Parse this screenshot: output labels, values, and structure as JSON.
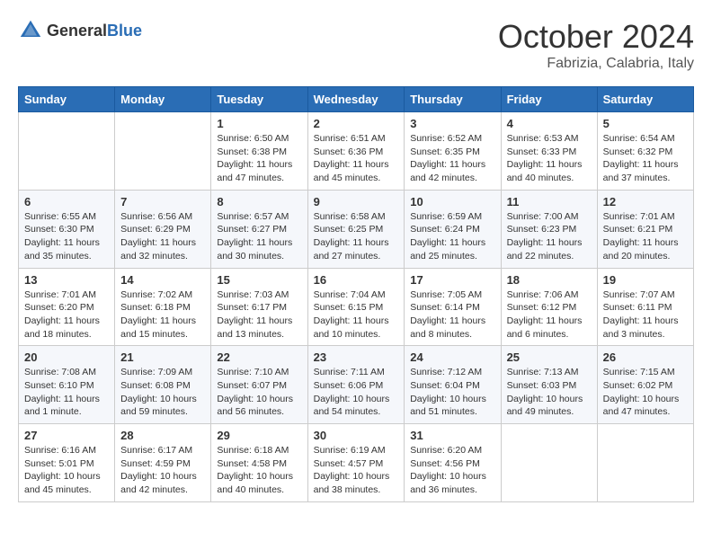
{
  "header": {
    "logo_general": "General",
    "logo_blue": "Blue",
    "month_title": "October 2024",
    "subtitle": "Fabrizia, Calabria, Italy"
  },
  "days_of_week": [
    "Sunday",
    "Monday",
    "Tuesday",
    "Wednesday",
    "Thursday",
    "Friday",
    "Saturday"
  ],
  "weeks": [
    [
      {
        "day": "",
        "content": ""
      },
      {
        "day": "",
        "content": ""
      },
      {
        "day": "1",
        "content": "Sunrise: 6:50 AM\nSunset: 6:38 PM\nDaylight: 11 hours and 47 minutes."
      },
      {
        "day": "2",
        "content": "Sunrise: 6:51 AM\nSunset: 6:36 PM\nDaylight: 11 hours and 45 minutes."
      },
      {
        "day": "3",
        "content": "Sunrise: 6:52 AM\nSunset: 6:35 PM\nDaylight: 11 hours and 42 minutes."
      },
      {
        "day": "4",
        "content": "Sunrise: 6:53 AM\nSunset: 6:33 PM\nDaylight: 11 hours and 40 minutes."
      },
      {
        "day": "5",
        "content": "Sunrise: 6:54 AM\nSunset: 6:32 PM\nDaylight: 11 hours and 37 minutes."
      }
    ],
    [
      {
        "day": "6",
        "content": "Sunrise: 6:55 AM\nSunset: 6:30 PM\nDaylight: 11 hours and 35 minutes."
      },
      {
        "day": "7",
        "content": "Sunrise: 6:56 AM\nSunset: 6:29 PM\nDaylight: 11 hours and 32 minutes."
      },
      {
        "day": "8",
        "content": "Sunrise: 6:57 AM\nSunset: 6:27 PM\nDaylight: 11 hours and 30 minutes."
      },
      {
        "day": "9",
        "content": "Sunrise: 6:58 AM\nSunset: 6:25 PM\nDaylight: 11 hours and 27 minutes."
      },
      {
        "day": "10",
        "content": "Sunrise: 6:59 AM\nSunset: 6:24 PM\nDaylight: 11 hours and 25 minutes."
      },
      {
        "day": "11",
        "content": "Sunrise: 7:00 AM\nSunset: 6:23 PM\nDaylight: 11 hours and 22 minutes."
      },
      {
        "day": "12",
        "content": "Sunrise: 7:01 AM\nSunset: 6:21 PM\nDaylight: 11 hours and 20 minutes."
      }
    ],
    [
      {
        "day": "13",
        "content": "Sunrise: 7:01 AM\nSunset: 6:20 PM\nDaylight: 11 hours and 18 minutes."
      },
      {
        "day": "14",
        "content": "Sunrise: 7:02 AM\nSunset: 6:18 PM\nDaylight: 11 hours and 15 minutes."
      },
      {
        "day": "15",
        "content": "Sunrise: 7:03 AM\nSunset: 6:17 PM\nDaylight: 11 hours and 13 minutes."
      },
      {
        "day": "16",
        "content": "Sunrise: 7:04 AM\nSunset: 6:15 PM\nDaylight: 11 hours and 10 minutes."
      },
      {
        "day": "17",
        "content": "Sunrise: 7:05 AM\nSunset: 6:14 PM\nDaylight: 11 hours and 8 minutes."
      },
      {
        "day": "18",
        "content": "Sunrise: 7:06 AM\nSunset: 6:12 PM\nDaylight: 11 hours and 6 minutes."
      },
      {
        "day": "19",
        "content": "Sunrise: 7:07 AM\nSunset: 6:11 PM\nDaylight: 11 hours and 3 minutes."
      }
    ],
    [
      {
        "day": "20",
        "content": "Sunrise: 7:08 AM\nSunset: 6:10 PM\nDaylight: 11 hours and 1 minute."
      },
      {
        "day": "21",
        "content": "Sunrise: 7:09 AM\nSunset: 6:08 PM\nDaylight: 10 hours and 59 minutes."
      },
      {
        "day": "22",
        "content": "Sunrise: 7:10 AM\nSunset: 6:07 PM\nDaylight: 10 hours and 56 minutes."
      },
      {
        "day": "23",
        "content": "Sunrise: 7:11 AM\nSunset: 6:06 PM\nDaylight: 10 hours and 54 minutes."
      },
      {
        "day": "24",
        "content": "Sunrise: 7:12 AM\nSunset: 6:04 PM\nDaylight: 10 hours and 51 minutes."
      },
      {
        "day": "25",
        "content": "Sunrise: 7:13 AM\nSunset: 6:03 PM\nDaylight: 10 hours and 49 minutes."
      },
      {
        "day": "26",
        "content": "Sunrise: 7:15 AM\nSunset: 6:02 PM\nDaylight: 10 hours and 47 minutes."
      }
    ],
    [
      {
        "day": "27",
        "content": "Sunrise: 6:16 AM\nSunset: 5:01 PM\nDaylight: 10 hours and 45 minutes."
      },
      {
        "day": "28",
        "content": "Sunrise: 6:17 AM\nSunset: 4:59 PM\nDaylight: 10 hours and 42 minutes."
      },
      {
        "day": "29",
        "content": "Sunrise: 6:18 AM\nSunset: 4:58 PM\nDaylight: 10 hours and 40 minutes."
      },
      {
        "day": "30",
        "content": "Sunrise: 6:19 AM\nSunset: 4:57 PM\nDaylight: 10 hours and 38 minutes."
      },
      {
        "day": "31",
        "content": "Sunrise: 6:20 AM\nSunset: 4:56 PM\nDaylight: 10 hours and 36 minutes."
      },
      {
        "day": "",
        "content": ""
      },
      {
        "day": "",
        "content": ""
      }
    ]
  ]
}
